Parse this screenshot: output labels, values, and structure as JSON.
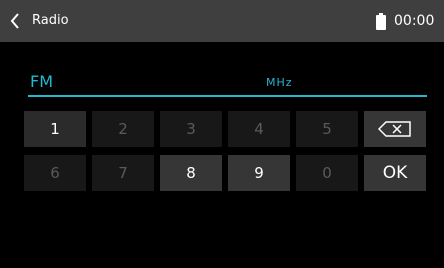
{
  "header": {
    "title": "Radio",
    "clock": "00:00",
    "back_icon": "chevron-left-icon",
    "battery_icon": "battery-icon"
  },
  "frequency": {
    "band": "FM",
    "unit": "MHz",
    "value": ""
  },
  "keypad": {
    "row1": [
      "1",
      "2",
      "3",
      "4",
      "5"
    ],
    "row2": [
      "6",
      "7",
      "8",
      "9",
      "0",
      "OK"
    ],
    "delete_icon": "backspace-icon"
  },
  "colors": {
    "accent": "#25b6d2",
    "topbar": "#3f3f3f",
    "key_active": "#363636",
    "key_inactive": "#181818"
  }
}
